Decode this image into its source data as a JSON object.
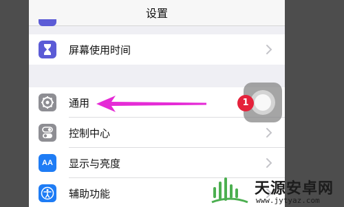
{
  "nav": {
    "title": "设置"
  },
  "rows": [
    {
      "label": "屏幕使用时间",
      "icon": "hourglass-icon",
      "color": "#5b5bd6"
    },
    {
      "label": "通用",
      "icon": "gear-icon",
      "color": "#8e8e93"
    },
    {
      "label": "控制中心",
      "icon": "toggle-icon",
      "color": "#8e8e93"
    },
    {
      "label": "显示与亮度",
      "icon": "text-size-icon",
      "icon_text": "AA",
      "color": "#1e7cf5"
    },
    {
      "label": "辅助功能",
      "icon": "accessibility-icon",
      "color": "#1e7cf5"
    }
  ],
  "badge": {
    "count": "1",
    "color": "#e5223b"
  },
  "annotation": {
    "arrow_color": "#e52bd6"
  },
  "watermark": {
    "title": "天源安卓网",
    "url": "www.jytyaz.com",
    "logo": "android-logo-icon",
    "color": "#4caf50"
  }
}
